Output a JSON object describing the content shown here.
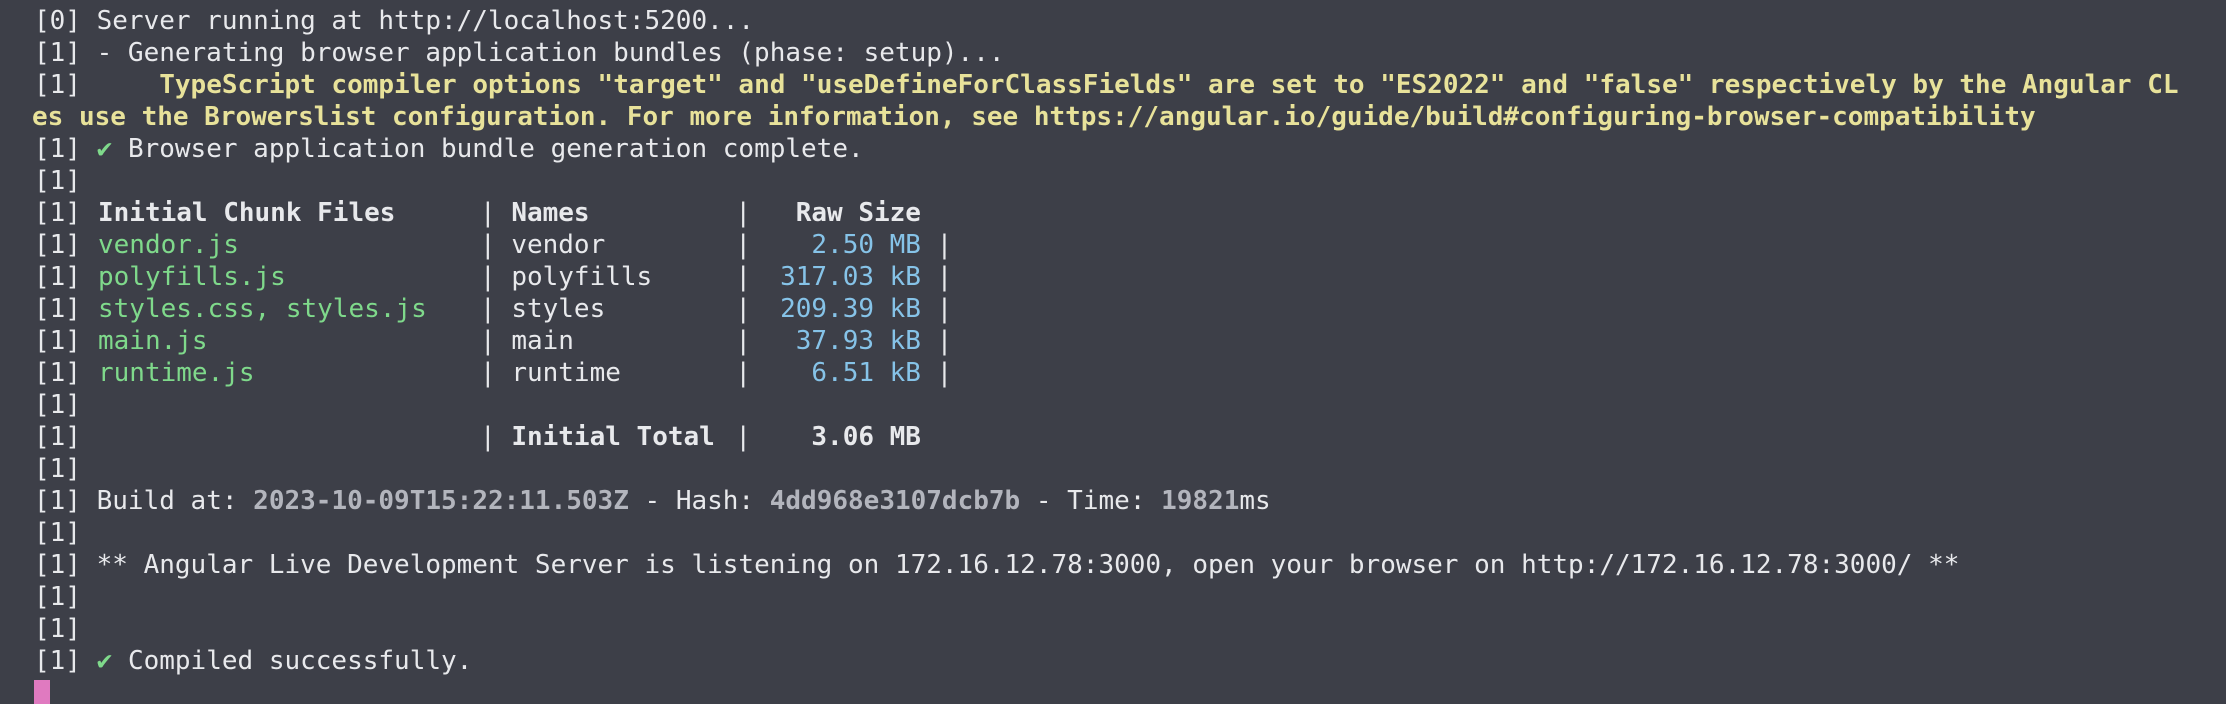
{
  "terminal": {
    "lines": {
      "l0": "[0] Server running at http://localhost:5200...",
      "l1": "[1] - Generating browser application bundles (phase: setup)...",
      "l2_prefix": "[1]",
      "l2_warn": "TypeScript compiler options \"target\" and \"useDefineForClassFields\" are set to \"ES2022\" and \"false\" respectively by the Angular CL",
      "l3_warn": "es use the Browerslist configuration. For more information, see https://angular.io/guide/build#configuring-browser-compatibility",
      "l4_prefix": "[1]",
      "l4_check": "✔",
      "l4_text": "Browser application bundle generation complete.",
      "blank": "[1]"
    },
    "prefix": "[1]",
    "table": {
      "headers": {
        "files": "Initial Chunk Files",
        "names": "Names",
        "size": "Raw Size"
      },
      "rows": [
        {
          "file": "vendor.js",
          "name": "vendor",
          "size": "2.50 MB"
        },
        {
          "file": "polyfills.js",
          "name": "polyfills",
          "size": "317.03 kB"
        },
        {
          "file": "styles.css, styles.js",
          "name": "styles",
          "size": "209.39 kB"
        },
        {
          "file": "main.js",
          "name": "main",
          "size": "37.93 kB"
        },
        {
          "file": "runtime.js",
          "name": "runtime",
          "size": "6.51 kB"
        }
      ],
      "total_label": "Initial Total",
      "total_value": "3.06 MB"
    },
    "build": {
      "build_at_label": "Build at:",
      "build_at_value": "2023-10-09T15:22:11.503Z",
      "hash_label": "- Hash:",
      "hash_value": "4dd968e3107dcb7b",
      "time_label": "- Time:",
      "time_value": "19821",
      "time_unit": "ms"
    },
    "server_msg": "** Angular Live Development Server is listening on 172.16.12.78:3000, open your browser on http://172.16.12.78:3000/ **",
    "compiled_check": "✔",
    "compiled_text": "Compiled successfully.",
    "colors": {
      "background": "#3d3f48",
      "foreground": "#e8e9ec",
      "warning": "#e8e29a",
      "filename": "#7fd98b",
      "size": "#86c3e8",
      "cursor": "#e07ac0"
    }
  }
}
